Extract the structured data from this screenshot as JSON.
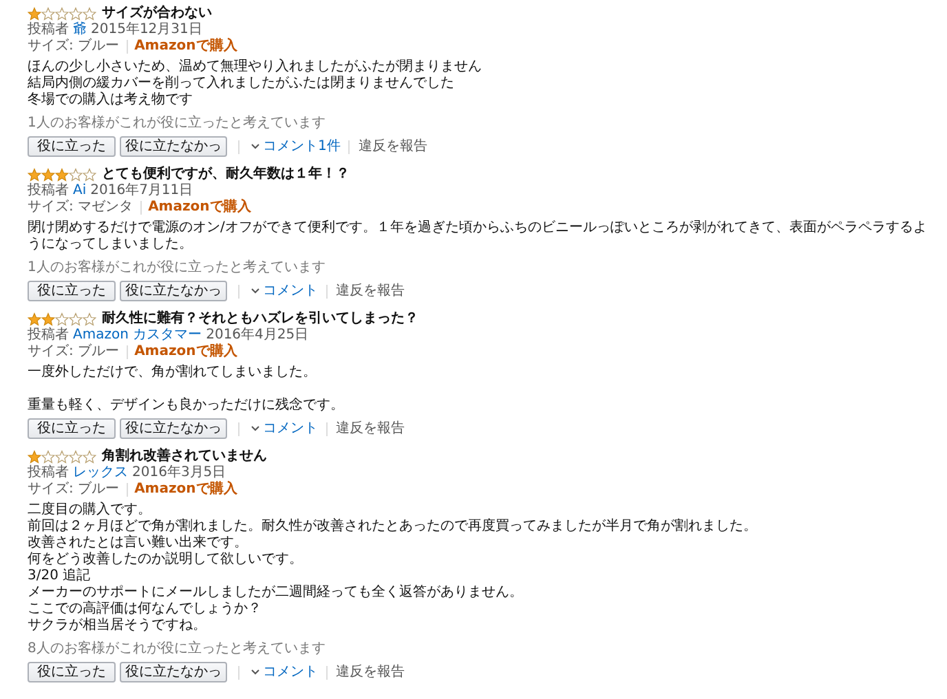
{
  "reviews": [
    {
      "stars": 1,
      "title": "サイズが合わない",
      "by": "投稿者",
      "author": "爺",
      "date": "2015年12月31日",
      "size": "サイズ: ブルー",
      "verified": "Amazonで購入",
      "body": [
        [
          "ほんの少し小さいため、温めて無理やり入れましたがふたが閉まりません",
          "結局内側の緩カバーを削って入れましたがふたは閉まりませんでした",
          "冬場での購入は考え物です"
        ]
      ],
      "helpful": "1人のお客様がこれが役に立ったと考えています",
      "yes": "役に立った",
      "no": "役に立たなかっ",
      "comment": "コメント1件",
      "report": "違反を報告"
    },
    {
      "stars": 3,
      "title": "とても便利ですが、耐久年数は１年！？",
      "by": "投稿者",
      "author": "Ai",
      "date": "2016年7月11日",
      "size": "サイズ: マゼンタ",
      "verified": "Amazonで購入",
      "body": [
        [
          "閉け閉めするだけで電源のオン/オフができて便利です。１年を過ぎた頃からふちのビニールっぽいところが剥がれてきて、表面がペラペラするようになってしまいました。"
        ]
      ],
      "helpful": "1人のお客様がこれが役に立ったと考えています",
      "yes": "役に立った",
      "no": "役に立たなかっ",
      "comment": "コメント",
      "report": "違反を報告"
    },
    {
      "stars": 2,
      "title": "耐久性に難有？それともハズレを引いてしまった？",
      "by": "投稿者",
      "author": "Amazon カスタマー",
      "date": "2016年4月25日",
      "size": "サイズ: ブルー",
      "verified": "Amazonで購入",
      "body": [
        [
          "一度外しただけで、角が割れてしまいました。"
        ],
        [
          "重量も軽く、デザインも良かっただけに残念です。"
        ]
      ],
      "yes": "役に立った",
      "no": "役に立たなかっ",
      "comment": "コメント",
      "report": "違反を報告"
    },
    {
      "stars": 1,
      "title": "角割れ改善されていません",
      "by": "投稿者",
      "author": "レックス",
      "date": "2016年3月5日",
      "size": "サイズ: ブルー",
      "verified": "Amazonで購入",
      "body": [
        [
          "二度目の購入です。",
          "前回は２ヶ月ほどで角が割れました。耐久性が改善されたとあったので再度買ってみましたが半月で角が割れました。",
          "改善されたとは言い難い出来です。",
          "何をどう改善したのか説明して欲しいです。",
          "3/20 追記",
          "メーカーのサポートにメールしましたが二週間経っても全く返答がありません。",
          "ここでの高評価は何なんでしょうか？",
          "サクラが相当居そうですね。"
        ]
      ],
      "helpful": "8人のお客様がこれが役に立ったと考えています",
      "yes": "役に立った",
      "no": "役に立たなかっ",
      "comment": "コメント",
      "report": "違反を報告"
    }
  ]
}
